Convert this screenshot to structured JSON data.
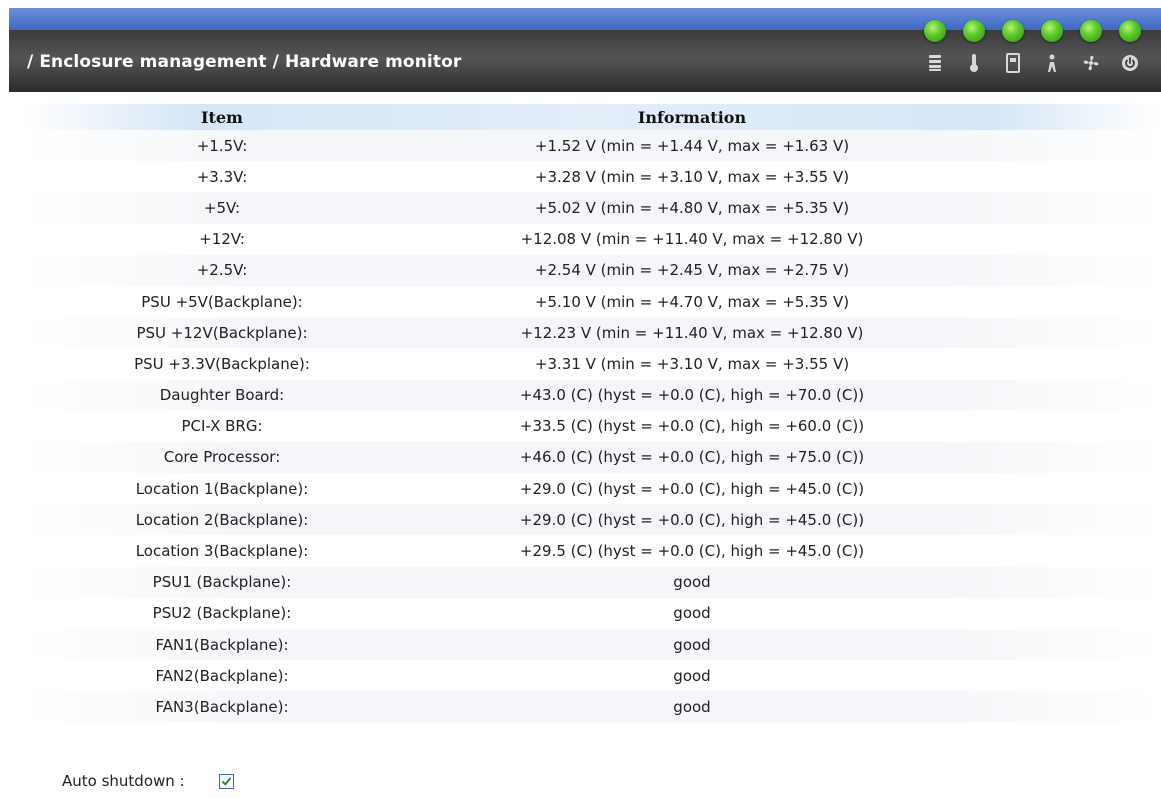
{
  "header": {
    "breadcrumb": "/ Enclosure management / Hardware monitor",
    "status_icons": [
      {
        "icon": "list-icon",
        "led": "green"
      },
      {
        "icon": "thermometer-icon",
        "led": "green"
      },
      {
        "icon": "power-supply-icon",
        "led": "green"
      },
      {
        "icon": "ups-icon",
        "led": "green"
      },
      {
        "icon": "fan-icon",
        "led": "green"
      },
      {
        "icon": "shutdown-icon",
        "led": "green"
      }
    ],
    "led_color": "#5ccb2a"
  },
  "table": {
    "columns": [
      "Item",
      "Information"
    ],
    "rows": [
      {
        "item": "+1.5V:",
        "info": "+1.52 V (min = +1.44 V, max = +1.63 V)"
      },
      {
        "item": "+3.3V:",
        "info": "+3.28 V (min = +3.10 V, max = +3.55 V)"
      },
      {
        "item": "+5V:",
        "info": "+5.02 V (min = +4.80 V, max = +5.35 V)"
      },
      {
        "item": "+12V:",
        "info": "+12.08 V (min = +11.40 V, max = +12.80 V)"
      },
      {
        "item": "+2.5V:",
        "info": "+2.54 V (min = +2.45 V, max = +2.75 V)"
      },
      {
        "item": "PSU +5V(Backplane):",
        "info": "+5.10 V (min = +4.70 V, max = +5.35 V)"
      },
      {
        "item": "PSU +12V(Backplane):",
        "info": "+12.23 V (min = +11.40 V, max = +12.80 V)"
      },
      {
        "item": "PSU +3.3V(Backplane):",
        "info": "+3.31 V (min = +3.10 V, max = +3.55 V)"
      },
      {
        "item": "Daughter Board:",
        "info": "+43.0 (C) (hyst = +0.0 (C), high = +70.0 (C))"
      },
      {
        "item": "PCI-X BRG:",
        "info": "+33.5 (C) (hyst = +0.0 (C), high = +60.0 (C))"
      },
      {
        "item": "Core Processor:",
        "info": "+46.0 (C) (hyst = +0.0 (C), high = +75.0 (C))"
      },
      {
        "item": "Location 1(Backplane):",
        "info": "+29.0 (C) (hyst = +0.0 (C), high = +45.0 (C))"
      },
      {
        "item": "Location 2(Backplane):",
        "info": "+29.0 (C) (hyst = +0.0 (C), high = +45.0 (C))"
      },
      {
        "item": "Location 3(Backplane):",
        "info": "+29.5 (C) (hyst = +0.0 (C), high = +45.0 (C))"
      },
      {
        "item": "PSU1 (Backplane):",
        "info": "good"
      },
      {
        "item": "PSU2 (Backplane):",
        "info": "good"
      },
      {
        "item": "FAN1(Backplane):",
        "info": "good"
      },
      {
        "item": "FAN2(Backplane):",
        "info": "good"
      },
      {
        "item": "FAN3(Backplane):",
        "info": "good"
      }
    ]
  },
  "auto_shutdown": {
    "label": "Auto shutdown :",
    "checked": true
  }
}
